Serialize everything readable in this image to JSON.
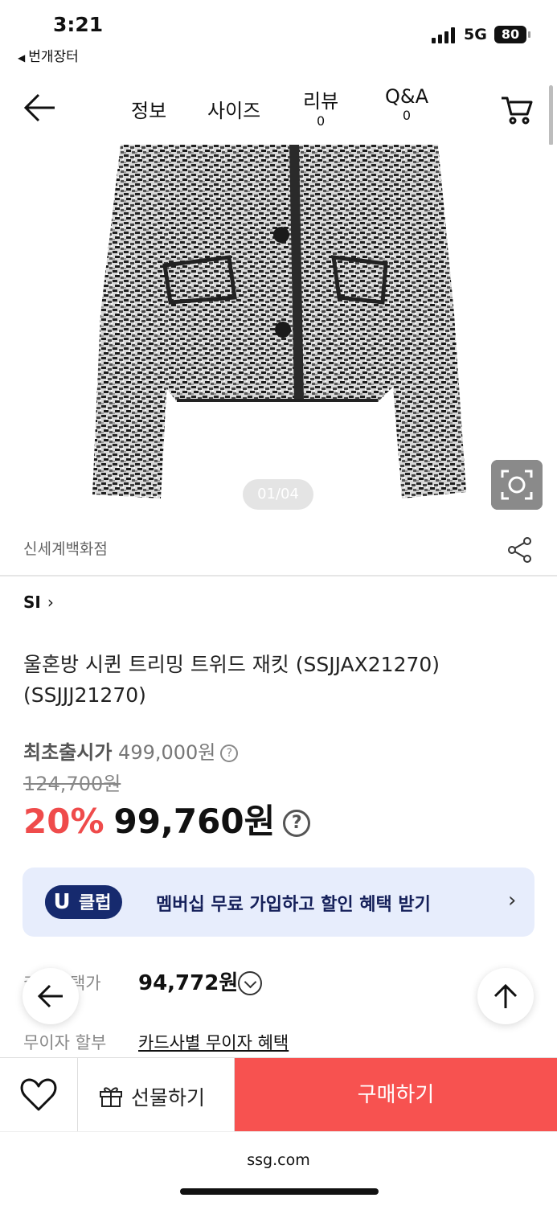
{
  "status": {
    "time": "3:21",
    "back_app": "번개장터",
    "network": "5G",
    "battery": "80"
  },
  "header": {
    "tabs": [
      {
        "label": "정보",
        "count": ""
      },
      {
        "label": "사이즈",
        "count": ""
      },
      {
        "label": "리뷰",
        "count": "0"
      },
      {
        "label": "Q&A",
        "count": "0"
      }
    ]
  },
  "gallery": {
    "counter": "01/04"
  },
  "seller": "신세계백화점",
  "brand": "SI",
  "product": {
    "title": "울혼방 시퀸 트리밍 트위드 재킷 (SSJJAX21270)(SSJJJ21270)"
  },
  "price": {
    "original_label": "최초출시가",
    "original_value": "499,000원",
    "strike_price": "124,700원",
    "discount": "20%",
    "final": "99,760원",
    "help": "?"
  },
  "uclub": {
    "badge_u": "U",
    "badge_text": "클럽",
    "text": "멤버십 무료 가입하고 할인 혜택 받기"
  },
  "card": {
    "label": "카드혜택가",
    "price": "94,772원"
  },
  "installment": {
    "label": "무이자 할부",
    "link": "카드사별 무이자 혜택"
  },
  "bottom": {
    "gift": "선물하기",
    "buy": "구매하기"
  },
  "footer": {
    "url": "ssg.com"
  },
  "colors": {
    "accent": "#f75250",
    "discount": "#ef4b4b",
    "uclub_bg": "#e7edfc",
    "uclub_badge": "#162a6e"
  }
}
